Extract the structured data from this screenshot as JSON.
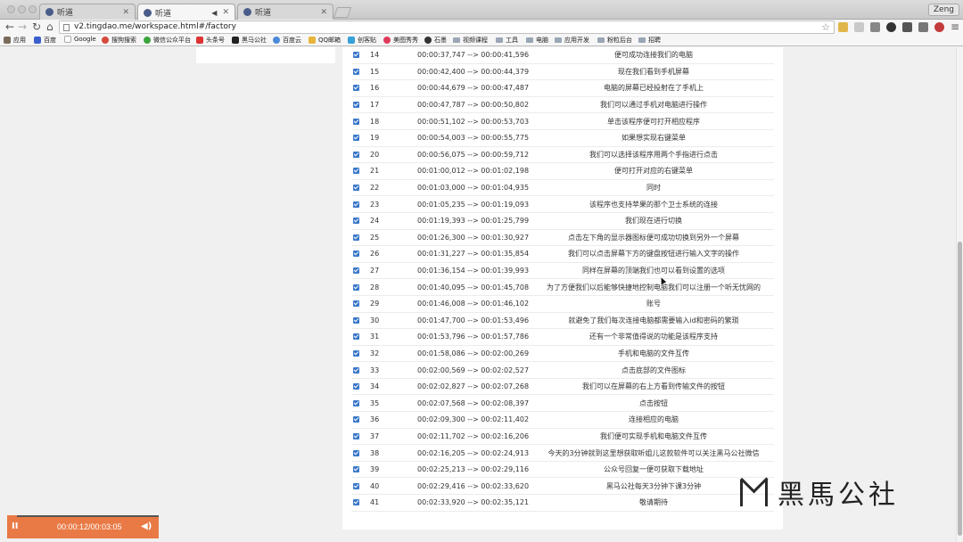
{
  "browser": {
    "tabs": [
      {
        "label": "听道",
        "active": false
      },
      {
        "label": "听道",
        "active": true
      },
      {
        "label": "听道",
        "active": false
      }
    ],
    "profile": "Zeng",
    "url": "v2.tingdao.me/workspace.html#/factory",
    "bookmarks": [
      "应用",
      "百度",
      "Google",
      "搜狗搜索",
      "微信公众平台",
      "头条号",
      "黑马公社",
      "百度云",
      "QQ邮箱",
      "创客贴",
      "美图秀秀",
      "石墨",
      "视频课程",
      "工具",
      "电脑",
      "应用开发",
      "粉粒后台",
      "招聘"
    ]
  },
  "subtitles": [
    {
      "index": "14",
      "time": "00:00:37,747 --> 00:00:41,596",
      "text": "便可成功连接我们的电脑"
    },
    {
      "index": "15",
      "time": "00:00:42,400 --> 00:00:44,379",
      "text": "现在我们看到手机屏幕"
    },
    {
      "index": "16",
      "time": "00:00:44,679 --> 00:00:47,487",
      "text": "电脑的屏幕已经投射在了手机上"
    },
    {
      "index": "17",
      "time": "00:00:47,787 --> 00:00:50,802",
      "text": "我们可以通过手机对电脑进行操作"
    },
    {
      "index": "18",
      "time": "00:00:51,102 --> 00:00:53,703",
      "text": "单击该程序便可打开相应程序"
    },
    {
      "index": "19",
      "time": "00:00:54,003 --> 00:00:55,775",
      "text": "如果想实现右键菜单"
    },
    {
      "index": "20",
      "time": "00:00:56,075 --> 00:00:59,712",
      "text": "我们可以选择该程序用两个手指进行点击"
    },
    {
      "index": "21",
      "time": "00:01:00,012 --> 00:01:02,198",
      "text": "便可打开对应的右键菜单"
    },
    {
      "index": "22",
      "time": "00:01:03,000 --> 00:01:04,935",
      "text": "同时"
    },
    {
      "index": "23",
      "time": "00:01:05,235 --> 00:01:19,093",
      "text": "该程序也支持苹果的那个卫士系统的连接"
    },
    {
      "index": "24",
      "time": "00:01:19,393 --> 00:01:25,799",
      "text": "我们现在进行切换"
    },
    {
      "index": "25",
      "time": "00:01:26,300 --> 00:01:30,927",
      "text": "点击左下角的显示器图标便可成功切换到另外一个屏幕"
    },
    {
      "index": "26",
      "time": "00:01:31,227 --> 00:01:35,854",
      "text": "我们可以点击屏幕下方的键盘按钮进行输入文字的操作"
    },
    {
      "index": "27",
      "time": "00:01:36,154 --> 00:01:39,993",
      "text": "同样在屏幕的顶端我们也可以看到设置的选项"
    },
    {
      "index": "28",
      "time": "00:01:40,095 --> 00:01:45,708",
      "text": "为了方便我们以后能够快捷地控制电脑我们可以注册一个听无忧网的"
    },
    {
      "index": "29",
      "time": "00:01:46,008 --> 00:01:46,102",
      "text": "账号"
    },
    {
      "index": "30",
      "time": "00:01:47,700 --> 00:01:53,496",
      "text": "就避免了我们每次连接电脑都需要输入id和密码的繁琐"
    },
    {
      "index": "31",
      "time": "00:01:53,796 --> 00:01:57,786",
      "text": "还有一个非常值得说的功能是该程序支持"
    },
    {
      "index": "32",
      "time": "00:01:58,086 --> 00:02:00,269",
      "text": "手机和电脑的文件互传"
    },
    {
      "index": "33",
      "time": "00:02:00,569 --> 00:02:02,527",
      "text": "点击底部的文件图标"
    },
    {
      "index": "34",
      "time": "00:02:02,827 --> 00:02:07,268",
      "text": "我们可以在屏幕的右上方看到传输文件的按钮"
    },
    {
      "index": "35",
      "time": "00:02:07,568 --> 00:02:08,397",
      "text": "点击按钮"
    },
    {
      "index": "36",
      "time": "00:02:09,300 --> 00:02:11,402",
      "text": "连接相应的电脑"
    },
    {
      "index": "37",
      "time": "00:02:11,702 --> 00:02:16,206",
      "text": "我们便可实现手机和电脑文件互传"
    },
    {
      "index": "38",
      "time": "00:02:16,205 --> 00:02:24,913",
      "text": "今天的3分钟就到这里想获取听姐儿这款软件可以关注黑马公社微信"
    },
    {
      "index": "39",
      "time": "00:02:25,213 --> 00:02:29,116",
      "text": "公众号回复一便可获取下载地址"
    },
    {
      "index": "40",
      "time": "00:02:29,416 --> 00:02:33,620",
      "text": "黑马公社每天3分钟下课3分钟"
    },
    {
      "index": "41",
      "time": "00:02:33,920 --> 00:02:35,121",
      "text": "敬请期待"
    }
  ],
  "player": {
    "time": "00:00:12/00:03:05",
    "progress": 0.065,
    "play_icon": "pause-icon",
    "volume_icon": "volume-icon"
  },
  "watermark": {
    "text": "黑馬公社"
  },
  "colors": {
    "checkbox": "#3b78c9",
    "player": "#e97a45"
  }
}
